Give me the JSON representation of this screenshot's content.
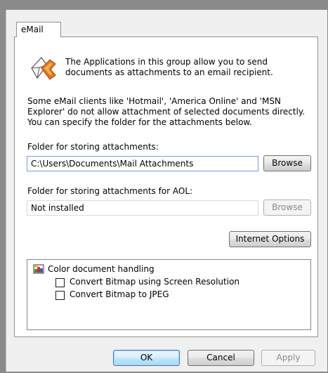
{
  "tab": {
    "label": "eMail"
  },
  "intro_text": "The Applications in this group allow you to send documents as attachments to an email recipient.",
  "description": "Some eMail clients like 'Hotmail', 'America Online' and 'MSN Explorer' do not allow attachment of selected documents directly. You can specify the folder for the attachments below.",
  "attachments": {
    "label": "Folder for storing attachments:",
    "value": "C:\\Users\\Documents\\Mail Attachments",
    "browse_label": "Browse"
  },
  "aol": {
    "label": "Folder for storing attachments for AOL:",
    "value": "Not installed",
    "browse_label": "Browse"
  },
  "internet_options_label": "Internet Options",
  "options_tree": {
    "group_label": "Color document handling",
    "items": [
      {
        "label": "Convert Bitmap using Screen Resolution",
        "checked": false
      },
      {
        "label": "Convert Bitmap to JPEG",
        "checked": false
      }
    ]
  },
  "footer": {
    "ok_label": "OK",
    "cancel_label": "Cancel",
    "apply_label": "Apply"
  },
  "icons": {
    "email_app": "envelope-arrow-icon",
    "group": "color-document-icon"
  }
}
